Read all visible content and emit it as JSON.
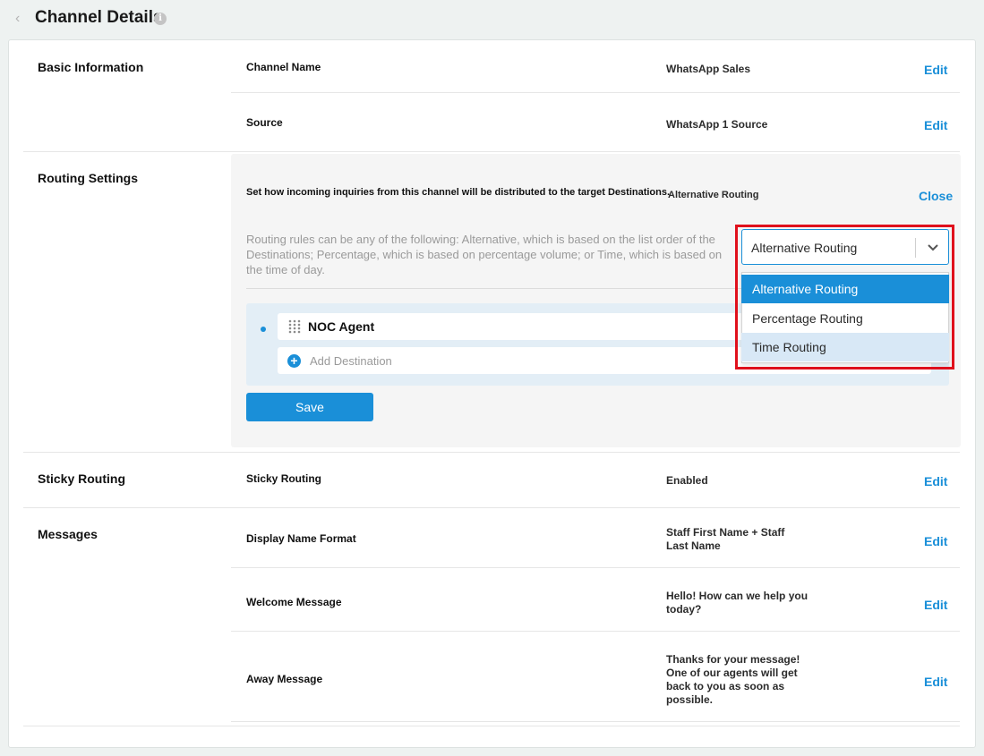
{
  "header": {
    "title": "Channel Details"
  },
  "sections": {
    "basic": {
      "title": "Basic Information",
      "rows": [
        {
          "label": "Channel Name",
          "value": "WhatsApp Sales",
          "action": "Edit"
        },
        {
          "label": "Source",
          "value": "WhatsApp 1 Source",
          "action": "Edit"
        }
      ]
    },
    "routing": {
      "title": "Routing Settings",
      "label": "Set how incoming inquiries from this channel will be distributed to the target Destinations.",
      "value": "Alternative Routing",
      "action": "Close",
      "description": "Routing rules can be any of the following: Alternative, which is based on the list order of the Destinations; Percentage, which is based on percentage volume; or Time, which is based on the time of day.",
      "destination": "NOC Agent",
      "add_destination": "Add Destination",
      "save_label": "Save",
      "select": {
        "selected": "Alternative Routing",
        "options": [
          "Alternative Routing",
          "Percentage Routing",
          "Time Routing"
        ]
      }
    },
    "sticky": {
      "title": "Sticky Routing",
      "rows": [
        {
          "label": "Sticky Routing",
          "value": "Enabled",
          "action": "Edit"
        }
      ]
    },
    "messages": {
      "title": "Messages",
      "rows": [
        {
          "label": "Display Name Format",
          "value": "Staff First Name + Staff Last Name",
          "action": "Edit"
        },
        {
          "label": "Welcome Message",
          "value": "Hello! How can we help you today?",
          "action": "Edit"
        },
        {
          "label": "Away Message",
          "value": "Thanks for your message! One of our agents will get back to you as soon as possible.",
          "action": "Edit"
        }
      ]
    }
  },
  "colors": {
    "accent": "#1a8fd8",
    "highlight": "#e0101c",
    "option_hover": "#d8e8f6"
  },
  "icons": {
    "back": "chevron-left-icon",
    "info": "info-icon",
    "grip": "drag-handle-icon",
    "add": "plus-circle-icon",
    "dropdown": "chevron-down-icon"
  }
}
